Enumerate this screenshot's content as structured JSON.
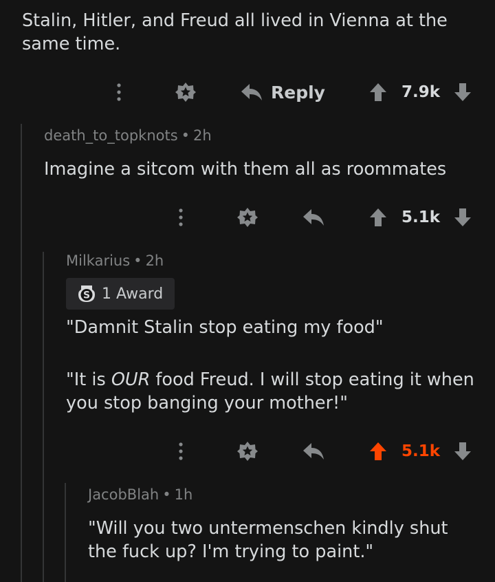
{
  "comments": [
    {
      "body": "Stalin, Hitler, and Freud all lived in Vienna at the same time.",
      "actions": {
        "reply_label": "Reply",
        "score": "7.9k"
      }
    },
    {
      "author": "death_to_topknots",
      "separator": "•",
      "age": "2h",
      "body": "Imagine a sitcom with them all as roommates",
      "actions": {
        "score": "5.1k"
      }
    },
    {
      "author": "Milkarius",
      "separator": "•",
      "age": "2h",
      "award_label": "1 Award",
      "body_p1": "\"Damnit Stalin stop eating my food\"",
      "body_p2_before": "\"It is ",
      "body_p2_em": "OUR",
      "body_p2_after": " food Freud. I will stop eating it when you stop banging your mother!\"",
      "actions": {
        "score": "5.1k",
        "upvoted": true
      }
    },
    {
      "author": "JacobBlah",
      "separator": "•",
      "age": "1h",
      "body": "\"Will you two untermenschen kindly shut the fuck up? I'm trying to paint.\""
    }
  ],
  "icons": {
    "more": "more-options-icon",
    "award": "award-icon",
    "reply": "reply-arrow-icon",
    "upvote": "upvote-icon",
    "downvote": "downvote-icon",
    "silver": "silver-award-icon"
  },
  "colors": {
    "background": "#141414",
    "text": "#d7dadc",
    "meta": "#818384",
    "icon": "#878a8c",
    "upvoted": "#ff4500",
    "thread_line": "#343536",
    "award_badge_bg": "#272729"
  }
}
